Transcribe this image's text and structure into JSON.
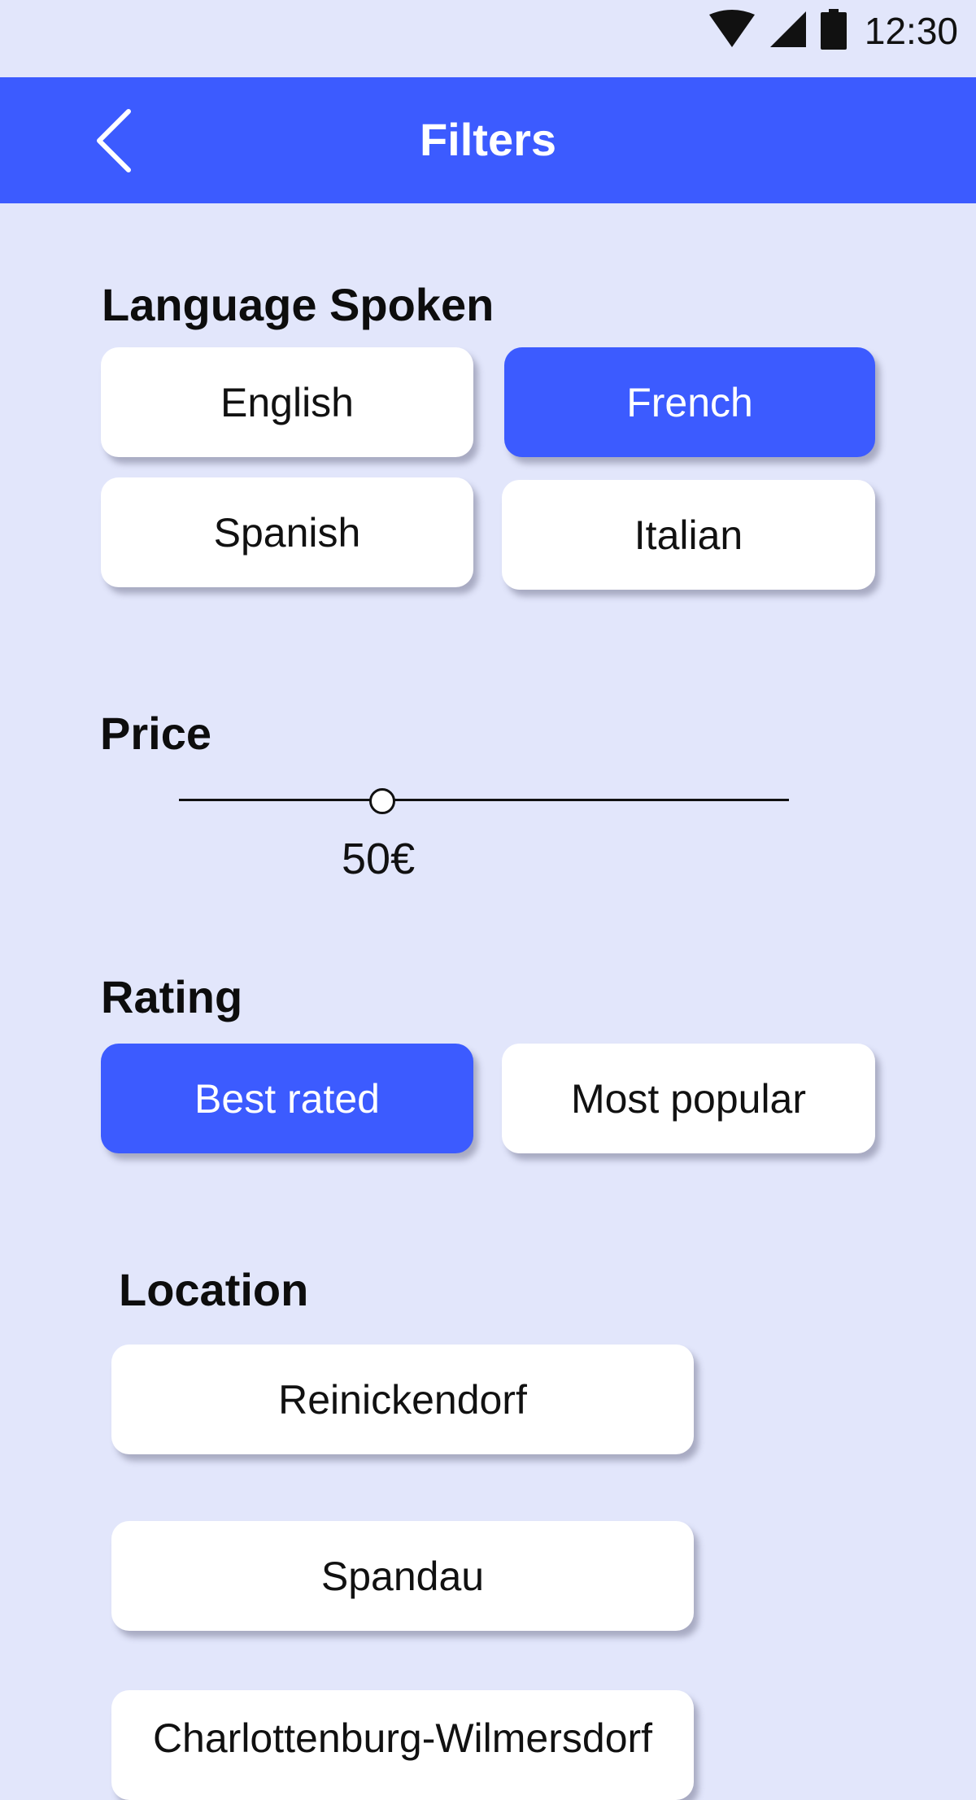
{
  "status_bar": {
    "time": "12:30",
    "icons": [
      "wifi-icon",
      "cellular-signal-icon",
      "battery-icon"
    ]
  },
  "header": {
    "title": "Filters",
    "back_icon": "chevron-left-icon"
  },
  "colors": {
    "accent": "#3c5bff",
    "background": "#e2e6fb",
    "chip": "#ffffff"
  },
  "language": {
    "title": "Language Spoken",
    "options": [
      {
        "label": "English",
        "selected": false
      },
      {
        "label": "French",
        "selected": true
      },
      {
        "label": "Spanish",
        "selected": false
      },
      {
        "label": "Italian",
        "selected": false
      }
    ]
  },
  "price": {
    "title": "Price",
    "value_label": "50€",
    "slider_fraction": 0.33
  },
  "rating": {
    "title": "Rating",
    "options": [
      {
        "label": "Best rated",
        "selected": true
      },
      {
        "label": "Most popular",
        "selected": false
      }
    ]
  },
  "location": {
    "title": "Location",
    "options": [
      {
        "label": "Reinickendorf"
      },
      {
        "label": "Spandau"
      },
      {
        "label": "Charlottenburg-Wilmersdorf"
      }
    ]
  }
}
